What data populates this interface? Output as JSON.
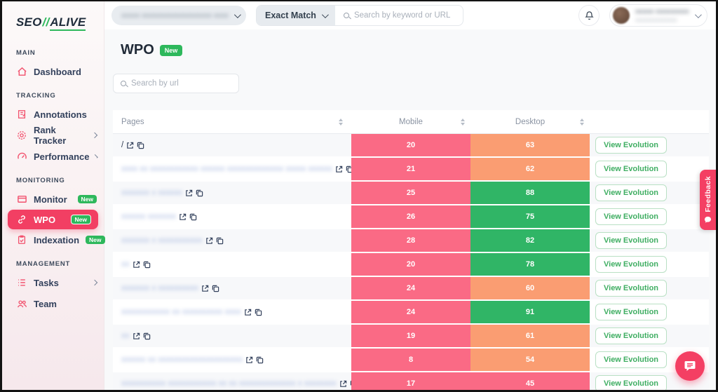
{
  "colors": {
    "accent": "#f43f63",
    "success_green": "#2eb85c",
    "cell_red": "#fa6a85",
    "cell_orange": "#fa9d72",
    "cell_green": "#30b566",
    "button_green": "#3fae62"
  },
  "logo": {
    "seo": "SEO",
    "slashes": "//",
    "alive": "ALIVE"
  },
  "topbar": {
    "site_url_blurred": "xxxxx xxxxxxxxxxxxxxxxxxx xxxx",
    "exact_match": "Exact Match",
    "search_placeholder": "Search by keyword or URL"
  },
  "user": {
    "name_blurred": "xxxxx xxxxxxxxx",
    "email_blurred": "xxxxxxxxxxxxxx"
  },
  "sidebar": {
    "sections": [
      {
        "label": "MAIN",
        "items": [
          {
            "label": "Dashboard"
          }
        ]
      },
      {
        "label": "TRACKING",
        "items": [
          {
            "label": "Annotations"
          },
          {
            "label": "Rank Tracker"
          },
          {
            "label": "Performance"
          }
        ]
      },
      {
        "label": "MONITORING",
        "items": [
          {
            "label": "Monitor",
            "badge": "New"
          },
          {
            "label": "WPO",
            "badge": "New"
          },
          {
            "label": "Indexation",
            "badge": "New"
          }
        ]
      },
      {
        "label": "MANAGEMENT",
        "items": [
          {
            "label": "Tasks"
          },
          {
            "label": "Team"
          }
        ]
      }
    ]
  },
  "main": {
    "title": "WPO",
    "badge": "New",
    "search_placeholder": "Search by url"
  },
  "labels": {
    "view_evolution": "View Evolution",
    "feedback": "Feedback"
  },
  "table": {
    "columns": [
      "Pages",
      "Mobile",
      "Desktop"
    ],
    "rows": [
      {
        "page": "/",
        "blurred": false,
        "mobile": "20",
        "mobile_color": "red",
        "desktop": "63",
        "desktop_color": "orange"
      },
      {
        "page": "xxxx xx xxxxxxxxxxxx xxxxxx xxxxxxxxxxxxxx xxxxx xxxxxx",
        "blurred": true,
        "mobile": "21",
        "mobile_color": "red",
        "desktop": "62",
        "desktop_color": "orange"
      },
      {
        "page": "xxxxxxx x xxxxxx",
        "blurred": true,
        "mobile": "25",
        "mobile_color": "red",
        "desktop": "88",
        "desktop_color": "green"
      },
      {
        "page": "xxxxxx xxxxxxx",
        "blurred": true,
        "mobile": "26",
        "mobile_color": "red",
        "desktop": "75",
        "desktop_color": "green"
      },
      {
        "page": "xxxxxxx x xxxxxxxxxxx",
        "blurred": true,
        "mobile": "28",
        "mobile_color": "red",
        "desktop": "82",
        "desktop_color": "green"
      },
      {
        "page": "xx",
        "blurred": true,
        "mobile": "20",
        "mobile_color": "red",
        "desktop": "78",
        "desktop_color": "green"
      },
      {
        "page": "xxxxxxx x xxxxxxxxxx",
        "blurred": true,
        "mobile": "24",
        "mobile_color": "red",
        "desktop": "60",
        "desktop_color": "orange"
      },
      {
        "page": "xxxxxxxxxxxx xx xxxxxxxxxx xxxx",
        "blurred": true,
        "mobile": "24",
        "mobile_color": "red",
        "desktop": "91",
        "desktop_color": "green"
      },
      {
        "page": "xx",
        "blurred": true,
        "mobile": "19",
        "mobile_color": "red",
        "desktop": "61",
        "desktop_color": "orange"
      },
      {
        "page": "xxxxxx xx xxxxxxxxxxxxxxxxxxxxx",
        "blurred": true,
        "mobile": "8",
        "mobile_color": "red",
        "desktop": "54",
        "desktop_color": "orange"
      },
      {
        "page": "xxxxxxxxxxx xxxxxxxxxxxx xx xx xxxxxxxxxxxxxx x xxxxxxxx",
        "blurred": true,
        "mobile": "17",
        "mobile_color": "red",
        "desktop": "45",
        "desktop_color": "red"
      }
    ]
  }
}
